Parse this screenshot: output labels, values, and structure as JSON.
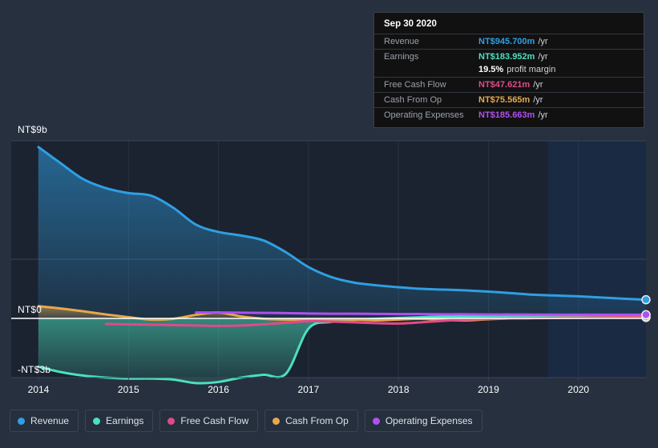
{
  "chart_data": {
    "type": "area",
    "title": "",
    "xlabel": "",
    "ylabel": "",
    "currency_prefix": "NT$",
    "xlim": [
      2013.75,
      2020.9
    ],
    "ylim": [
      -3,
      9
    ],
    "y_ticks": [
      {
        "value": 9,
        "label": "NT$9b"
      },
      {
        "value": 0,
        "label": "NT$0"
      },
      {
        "value": -3,
        "label": "-NT$3b"
      }
    ],
    "x_ticks": [
      "2014",
      "2015",
      "2016",
      "2017",
      "2018",
      "2019",
      "2020"
    ],
    "grid": true,
    "legend_position": "bottom",
    "highlight_band": {
      "from": 2019.66,
      "to": 2020.9
    },
    "series": [
      {
        "name": "Revenue",
        "color": "#2f9fe3",
        "fill": true,
        "x": [
          2014.0,
          2014.25,
          2014.5,
          2014.75,
          2015.0,
          2015.25,
          2015.5,
          2015.75,
          2016.0,
          2016.25,
          2016.5,
          2016.75,
          2017.0,
          2017.25,
          2017.5,
          2017.75,
          2018.0,
          2018.25,
          2018.5,
          2018.75,
          2019.0,
          2019.25,
          2019.5,
          2019.75,
          2020.0,
          2020.25,
          2020.5,
          2020.75
        ],
        "values": [
          8.68,
          7.85,
          7.05,
          6.6,
          6.35,
          6.22,
          5.6,
          4.75,
          4.38,
          4.2,
          3.95,
          3.35,
          2.6,
          2.1,
          1.82,
          1.68,
          1.58,
          1.5,
          1.46,
          1.42,
          1.36,
          1.28,
          1.2,
          1.16,
          1.12,
          1.06,
          1.0,
          0.9457
        ]
      },
      {
        "name": "Earnings",
        "color": "#4ae0c0",
        "fill": true,
        "x": [
          2014.0,
          2014.25,
          2014.5,
          2014.75,
          2015.0,
          2015.25,
          2015.5,
          2015.75,
          2016.0,
          2016.25,
          2016.5,
          2016.75,
          2017.0,
          2017.25,
          2017.5,
          2017.75,
          2018.0,
          2018.25,
          2018.5,
          2018.75,
          2019.0,
          2019.25,
          2019.5,
          2019.75,
          2020.0,
          2020.25,
          2020.5,
          2020.75
        ],
        "values": [
          -2.45,
          -2.72,
          -2.9,
          -3.0,
          -3.05,
          -3.05,
          -3.1,
          -3.28,
          -3.22,
          -3.0,
          -2.86,
          -2.8,
          -0.52,
          -0.18,
          -0.08,
          -0.02,
          0.02,
          0.06,
          0.1,
          0.1,
          0.11,
          0.12,
          0.14,
          0.15,
          0.16,
          0.17,
          0.18,
          0.184
        ]
      },
      {
        "name": "Free Cash Flow",
        "color": "#e04a8a",
        "fill": false,
        "x": [
          2014.75,
          2015.0,
          2015.25,
          2015.5,
          2015.75,
          2016.0,
          2016.25,
          2016.5,
          2016.75,
          2017.0,
          2017.25,
          2017.5,
          2017.75,
          2018.0,
          2018.25,
          2018.5,
          2018.75,
          2019.0,
          2019.25,
          2019.5,
          2019.75,
          2020.0,
          2020.25,
          2020.5,
          2020.75
        ],
        "values": [
          -0.28,
          -0.3,
          -0.32,
          -0.34,
          -0.36,
          -0.38,
          -0.36,
          -0.3,
          -0.22,
          -0.14,
          -0.16,
          -0.2,
          -0.24,
          -0.26,
          -0.2,
          -0.12,
          -0.06,
          -0.02,
          0.0,
          0.01,
          0.02,
          0.03,
          0.04,
          0.045,
          0.0476
        ]
      },
      {
        "name": "Cash From Op",
        "color": "#e8a84c",
        "fill": true,
        "x": [
          2014.0,
          2014.25,
          2014.5,
          2014.75,
          2015.0,
          2015.25,
          2015.5,
          2015.75,
          2016.0,
          2016.25,
          2016.5,
          2016.75,
          2017.0,
          2017.25,
          2017.5,
          2017.75,
          2018.0,
          2018.25,
          2018.5,
          2018.75,
          2019.0,
          2019.25,
          2019.5,
          2019.75,
          2020.0,
          2020.25,
          2020.5,
          2020.75
        ],
        "values": [
          0.62,
          0.5,
          0.36,
          0.2,
          0.06,
          -0.06,
          -0.02,
          0.18,
          0.3,
          0.1,
          -0.02,
          -0.06,
          -0.08,
          -0.04,
          -0.06,
          -0.1,
          -0.06,
          -0.02,
          -0.08,
          -0.1,
          -0.04,
          0.0,
          0.02,
          0.03,
          0.04,
          0.05,
          0.06,
          0.0756
        ]
      },
      {
        "name": "Operating Expenses",
        "color": "#b050f0",
        "fill": false,
        "x": [
          2015.75,
          2016.0,
          2016.25,
          2016.5,
          2016.75,
          2017.0,
          2017.25,
          2017.5,
          2017.75,
          2018.0,
          2018.25,
          2018.5,
          2018.75,
          2019.0,
          2019.25,
          2019.5,
          2019.75,
          2020.0,
          2020.25,
          2020.5,
          2020.75
        ],
        "values": [
          0.3,
          0.3,
          0.29,
          0.28,
          0.27,
          0.25,
          0.24,
          0.24,
          0.23,
          0.22,
          0.22,
          0.21,
          0.21,
          0.2,
          0.2,
          0.195,
          0.19,
          0.19,
          0.188,
          0.186,
          0.1857
        ]
      }
    ]
  },
  "tooltip": {
    "date": "Sep 30 2020",
    "rows": [
      {
        "key": "Revenue",
        "value": "NT$945.700m",
        "suffix": "/yr",
        "color": "#2f9fe3"
      },
      {
        "key": "Earnings",
        "value": "NT$183.952m",
        "suffix": "/yr",
        "color": "#4ae0c0"
      },
      {
        "key": "",
        "value": "19.5%",
        "suffix": "profit margin",
        "color": "#ffffff"
      },
      {
        "key": "Free Cash Flow",
        "value": "NT$47.621m",
        "suffix": "/yr",
        "color": "#e04a8a"
      },
      {
        "key": "Cash From Op",
        "value": "NT$75.565m",
        "suffix": "/yr",
        "color": "#e8a84c"
      },
      {
        "key": "Operating Expenses",
        "value": "NT$185.663m",
        "suffix": "/yr",
        "color": "#b050f0"
      }
    ]
  },
  "legend": {
    "items": [
      {
        "label": "Revenue",
        "color": "#2f9fe3"
      },
      {
        "label": "Earnings",
        "color": "#4ae0c0"
      },
      {
        "label": "Free Cash Flow",
        "color": "#e04a8a"
      },
      {
        "label": "Cash From Op",
        "color": "#e8a84c"
      },
      {
        "label": "Operating Expenses",
        "color": "#b050f0"
      }
    ]
  },
  "colors": {
    "background": "#26303f",
    "plot_background": "#1b2330",
    "highlight_band": "#1a2a42",
    "gridline": "#3b4454",
    "zero_line": "#ffffff",
    "axis_text": "#ffffff"
  }
}
